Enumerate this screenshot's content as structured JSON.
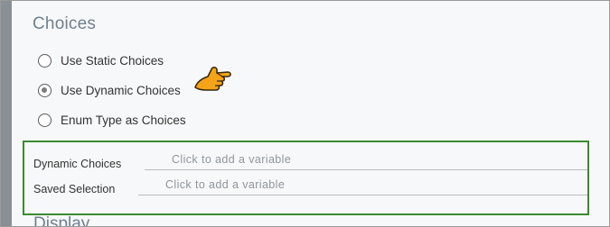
{
  "choices": {
    "title": "Choices",
    "options": [
      {
        "label": "Use Static Choices",
        "selected": false
      },
      {
        "label": "Use Dynamic Choices",
        "selected": true
      },
      {
        "label": "Enum Type as Choices",
        "selected": false
      }
    ]
  },
  "variables": {
    "dynamic_choices": {
      "label": "Dynamic Choices",
      "placeholder": "Click to add a variable"
    },
    "saved_selection": {
      "label": "Saved Selection",
      "placeholder": "Click to add a variable"
    }
  },
  "display": {
    "title": "Display"
  },
  "colors": {
    "section_title": "#6e7f91",
    "highlight_border": "#3b8a2f",
    "pointer_hand": "#f5a318"
  },
  "icons": {
    "pointer": "pointing-hand-icon"
  }
}
